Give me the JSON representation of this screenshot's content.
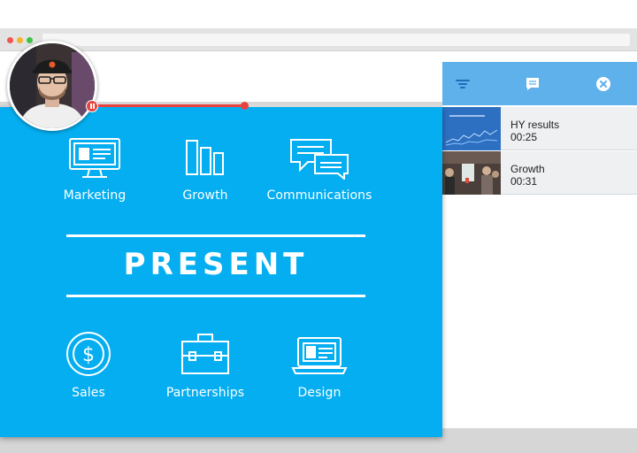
{
  "slide": {
    "title": "PRESENT",
    "top_tiles": [
      {
        "label": "Marketing",
        "icon": "monitor-icon"
      },
      {
        "label": "Growth",
        "icon": "bar-chart-icon"
      },
      {
        "label": "Communications",
        "icon": "chat-bubbles-icon"
      }
    ],
    "bottom_tiles": [
      {
        "label": "Sales",
        "icon": "dollar-coin-icon"
      },
      {
        "label": "Partnerships",
        "icon": "briefcase-icon"
      },
      {
        "label": "Design",
        "icon": "laptop-icon"
      }
    ],
    "background_color": "#05aef0"
  },
  "progress": {
    "value": 0.44,
    "color": "#e8423f"
  },
  "panel": {
    "header_color": "#5fb1eb",
    "icons": [
      "filter-icon",
      "comment-icon",
      "close-circle-icon"
    ],
    "items": [
      {
        "title": "HY results",
        "duration": "00:25",
        "thumbnail": "chart-thumbnail"
      },
      {
        "title": "Growth",
        "duration": "00:31",
        "thumbnail": "meeting-thumbnail"
      }
    ]
  }
}
